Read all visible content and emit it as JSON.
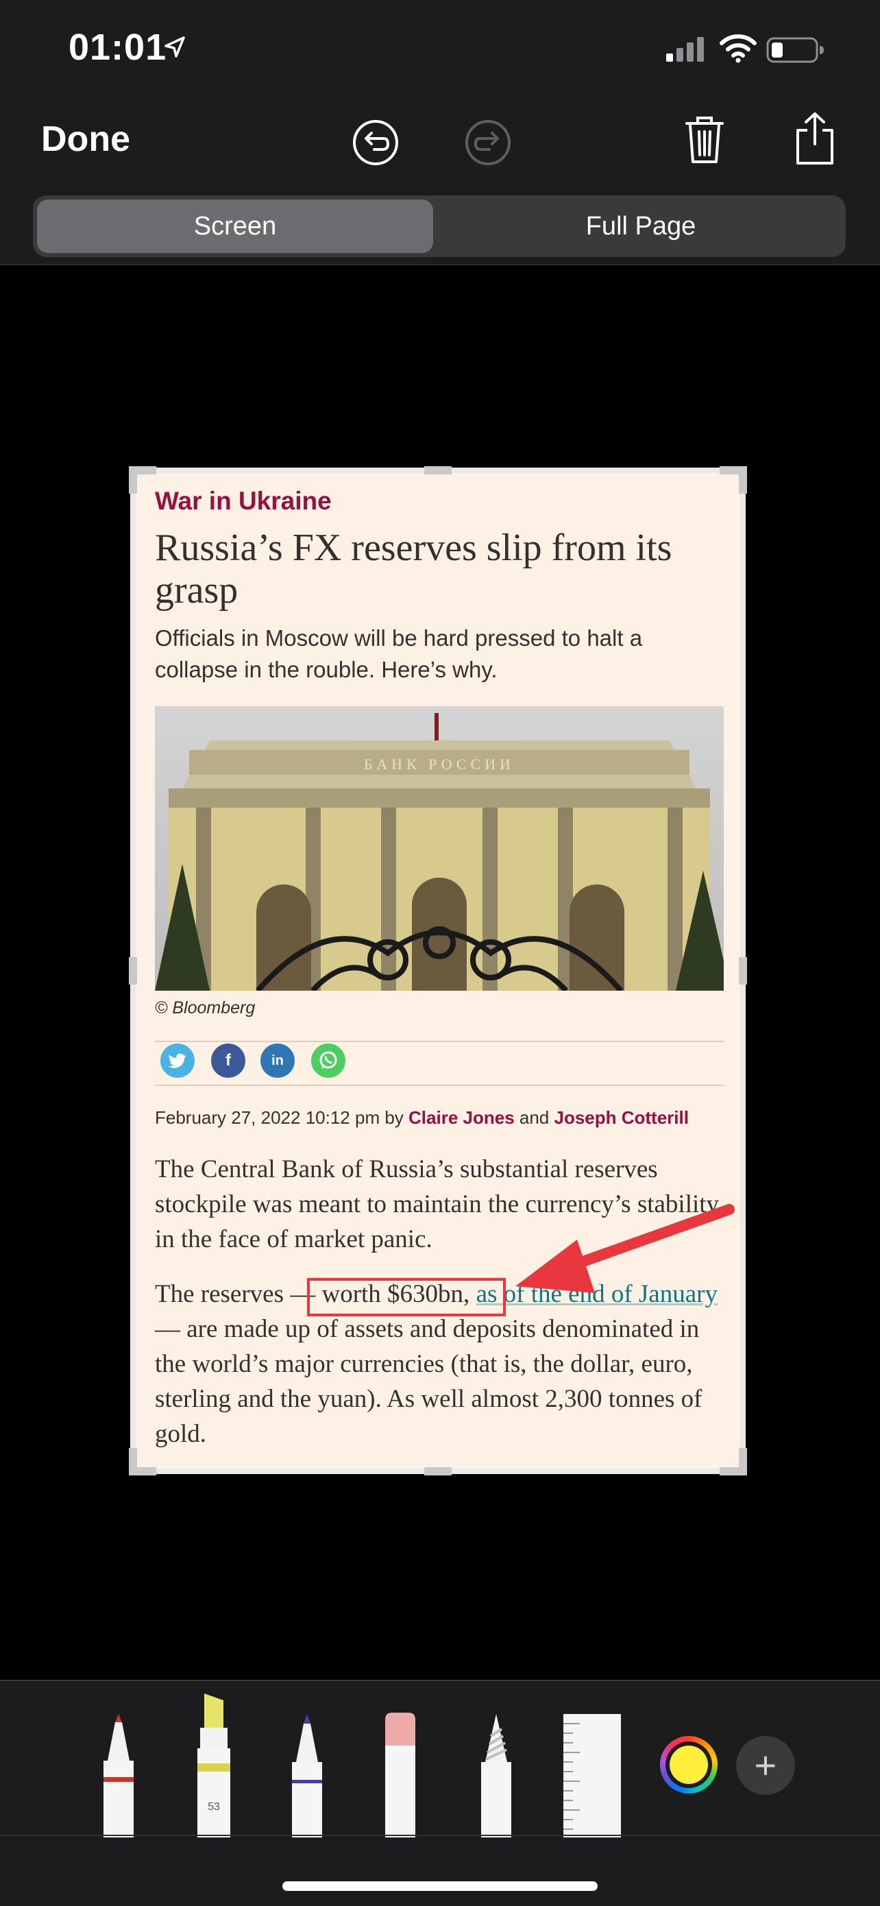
{
  "status": {
    "time": "01:01"
  },
  "toolbar": {
    "done_label": "Done"
  },
  "segments": {
    "screen": "Screen",
    "full_page": "Full Page"
  },
  "article": {
    "category": "War in Ukraine",
    "title": "Russia’s FX reserves slip from its grasp",
    "subtitle": "Officials in Moscow will be hard pressed to halt a collapse in the rouble. Here’s why.",
    "image_credit": "© Bloomberg",
    "building_sign": "БАНК РОССИИ",
    "byline": {
      "date": "February 27, 2022 10:12 pm by ",
      "author1": "Claire Jones",
      "and": " and ",
      "author2": "Joseph Cotterill"
    },
    "para1": "The Central Bank of Russia’s substantial reserves stockpile was meant to maintain the currency’s stability in the face of market panic.",
    "para2_a": "The reserves — worth $630bn, ",
    "para2_link": "as of the end of January",
    "para2_b": " — are made up of assets and deposits denominated in the world’s major currencies (that is, the dollar, euro, sterling and the yuan). As well almost 2,300 tonnes of gold."
  },
  "social": {
    "twitter": "t",
    "facebook": "f",
    "linkedin": "in",
    "whatsapp": "w"
  },
  "markup_tools": {
    "marker_number": "53",
    "add_label": "+",
    "selected_color": "#ffef3a"
  },
  "colors": {
    "accent": "#990f3d",
    "link": "#0d7680",
    "annotation": "#e8373f",
    "paper": "#fdf1e5"
  }
}
